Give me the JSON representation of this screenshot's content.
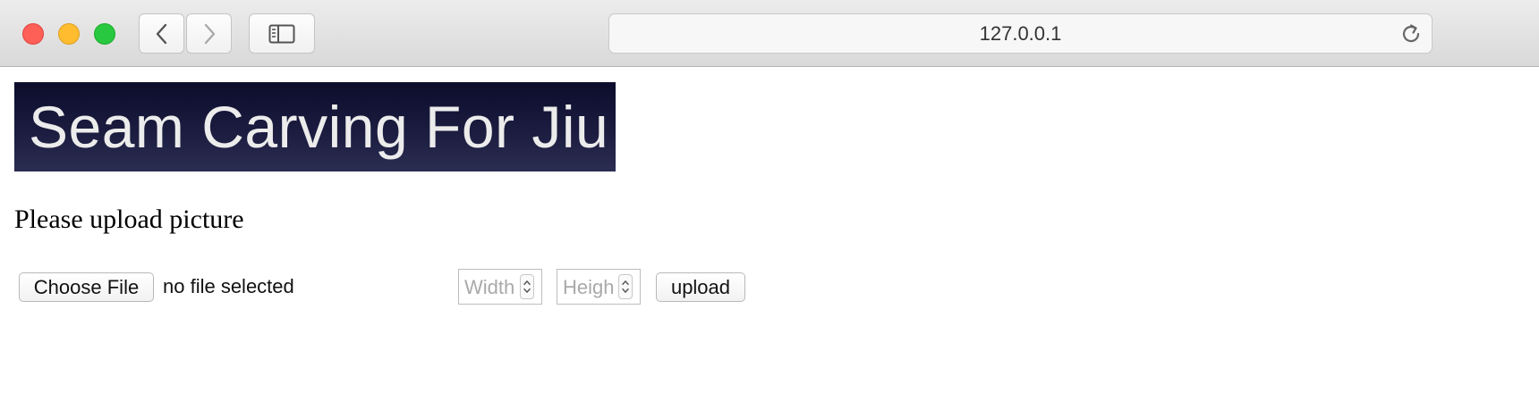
{
  "browser": {
    "url": "127.0.0.1",
    "icons": {
      "close": "close-window-icon",
      "minimize": "minimize-window-icon",
      "maximize": "maximize-window-icon",
      "back": "chevron-left-icon",
      "forward": "chevron-right-icon",
      "sidebar": "sidebar-icon",
      "reload": "reload-icon"
    },
    "colors": {
      "close": "#fe5f57",
      "minimize": "#febc2e",
      "maximize": "#28c840"
    }
  },
  "page": {
    "banner_text": "Seam Carving For Jiu",
    "heading": "Please upload picture",
    "form": {
      "choose_file_label": "Choose File",
      "file_status": "no file selected",
      "width_placeholder": "Width",
      "height_placeholder": "Height",
      "upload_label": "upload"
    },
    "colors": {
      "banner_bg": "#1b1c3f",
      "banner_text": "#ececec"
    }
  }
}
